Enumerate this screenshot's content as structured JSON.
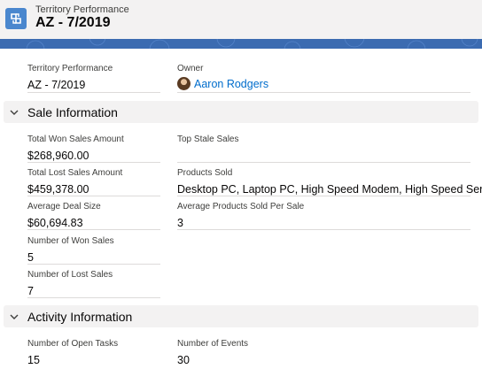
{
  "header": {
    "object_type": "Territory Performance",
    "record_title": "AZ - 7/2019"
  },
  "top_fields": {
    "territory_performance": {
      "label": "Territory Performance",
      "value": "AZ - 7/2019"
    },
    "owner": {
      "label": "Owner",
      "value": "Aaron Rodgers"
    }
  },
  "sale_information": {
    "title": "Sale Information",
    "total_won_sales_amount": {
      "label": "Total Won Sales Amount",
      "value": "$268,960.00"
    },
    "top_stale_sales": {
      "label": "Top Stale Sales",
      "value": ""
    },
    "total_lost_sales_amount": {
      "label": "Total Lost Sales Amount",
      "value": "$459,378.00"
    },
    "products_sold": {
      "label": "Products Sold",
      "value": "Desktop PC, Laptop PC, High Speed Modem, High Speed Server"
    },
    "average_deal_size": {
      "label": "Average Deal Size",
      "value": "$60,694.83"
    },
    "average_products_sold_per_sale": {
      "label": "Average Products Sold Per Sale",
      "value": "3"
    },
    "number_of_won_sales": {
      "label": "Number of Won Sales",
      "value": "5"
    },
    "number_of_lost_sales": {
      "label": "Number of Lost Sales",
      "value": "7"
    }
  },
  "activity_information": {
    "title": "Activity Information",
    "number_of_open_tasks": {
      "label": "Number of Open Tasks",
      "value": "15"
    },
    "number_of_events": {
      "label": "Number of Events",
      "value": "30"
    }
  },
  "colors": {
    "brand_blue": "#4a87ce",
    "banner_blue": "#3b6bb1",
    "link_blue": "#006dcc",
    "header_bg": "#f3f2f2",
    "divider": "#dddbda"
  },
  "icons": {
    "object_icon": "territory-performance-icon",
    "section_toggle": "chevron-down-icon"
  }
}
